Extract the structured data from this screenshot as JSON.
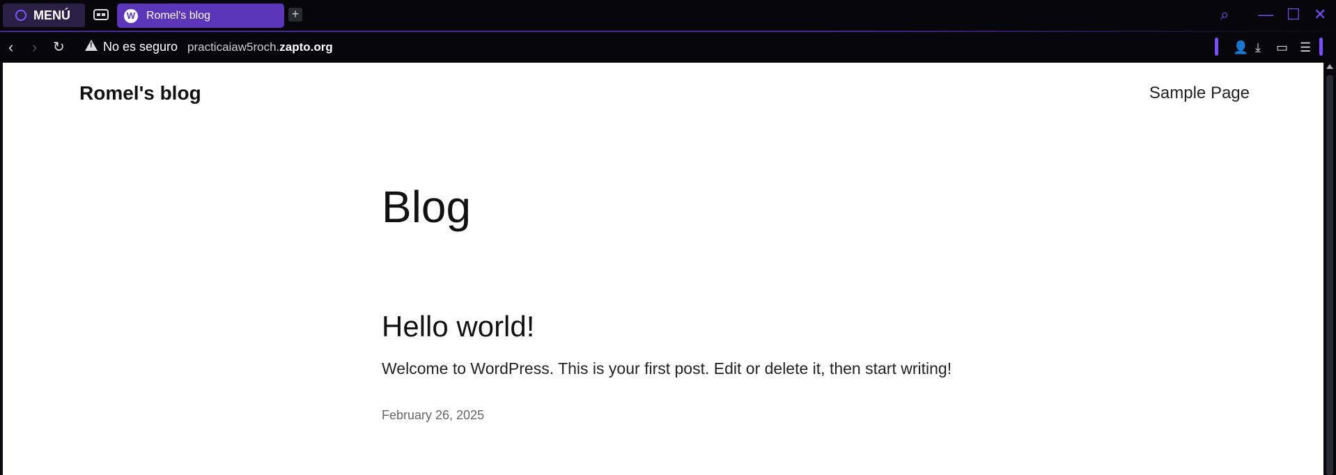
{
  "browser": {
    "menu_label": "MENÚ",
    "tab_title": "Romel's blog",
    "tab_icon": "wordpress-icon",
    "new_tab": "+",
    "security_text": "No es seguro",
    "url_prefix": "practicaiaw5roch.",
    "url_domain": "zapto.org",
    "accent_color": "#7a4dff"
  },
  "site": {
    "title": "Romel's blog",
    "nav_link": "Sample Page"
  },
  "main": {
    "heading": "Blog",
    "post": {
      "title": "Hello world!",
      "excerpt": "Welcome to WordPress. This is your first post. Edit or delete it, then start writing!",
      "date": "February 26, 2025"
    }
  }
}
